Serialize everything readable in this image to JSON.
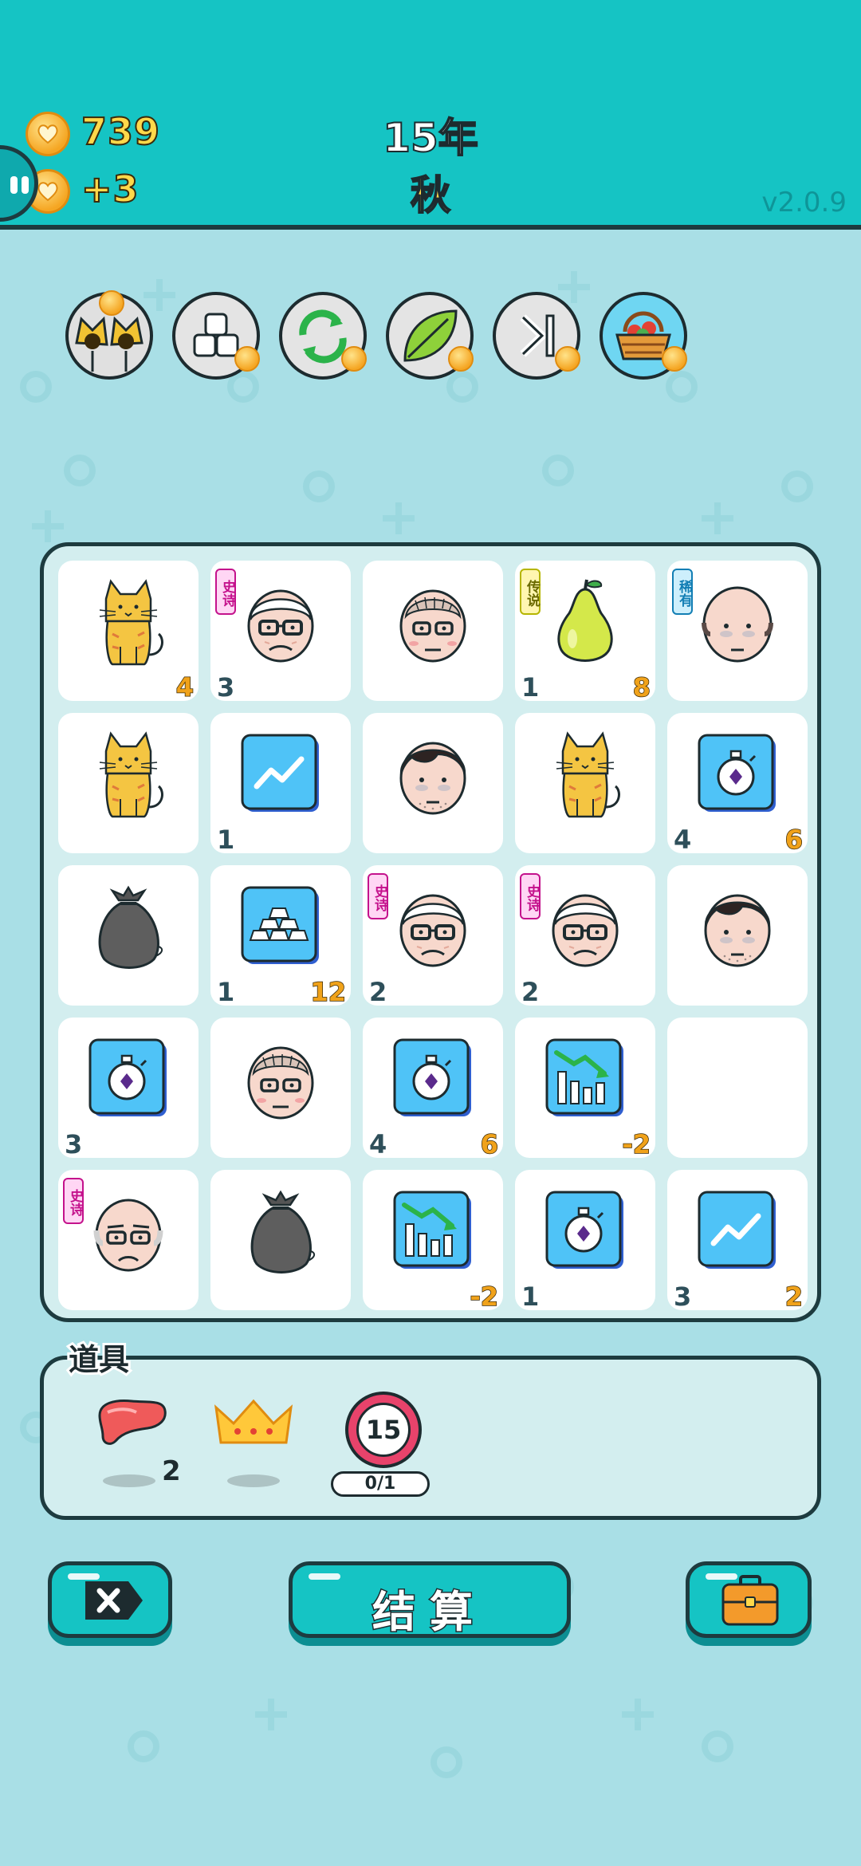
{
  "header": {
    "coins": "739",
    "income": "+3",
    "year": "15年",
    "season": "秋",
    "version": "v2.0.9"
  },
  "skills": [
    {
      "name": "two-cats-skill"
    },
    {
      "name": "sugar-cubes-skill"
    },
    {
      "name": "refresh-skill"
    },
    {
      "name": "leaf-skill"
    },
    {
      "name": "skip-skill"
    },
    {
      "name": "fruit-basket-skill"
    }
  ],
  "board": {
    "rows": [
      [
        {
          "item": "cat",
          "left": "",
          "right": "4",
          "badge": ""
        },
        {
          "item": "old-man-glasses",
          "left": "3",
          "right": "",
          "badge": "史诗",
          "badge_type": "epic"
        },
        {
          "item": "middle-aged-man",
          "left": "",
          "right": "",
          "badge": ""
        },
        {
          "item": "pear",
          "left": "1",
          "right": "8",
          "badge": "传说",
          "badge_type": "legend"
        },
        {
          "item": "bald-man",
          "left": "",
          "right": "",
          "badge": "稀有",
          "badge_type": "rare"
        }
      ],
      [
        {
          "item": "cat",
          "left": "",
          "right": "",
          "badge": ""
        },
        {
          "item": "rising-chart-card",
          "left": "1",
          "right": "",
          "badge": ""
        },
        {
          "item": "young-man",
          "left": "",
          "right": "",
          "badge": ""
        },
        {
          "item": "cat",
          "left": "",
          "right": "",
          "badge": ""
        },
        {
          "item": "stopwatch-card",
          "left": "4",
          "right": "6",
          "badge": ""
        }
      ],
      [
        {
          "item": "garbage-bag",
          "left": "",
          "right": "",
          "badge": ""
        },
        {
          "item": "gold-bars-card",
          "left": "1",
          "right": "12",
          "badge": ""
        },
        {
          "item": "old-man-glasses",
          "left": "2",
          "right": "",
          "badge": "史诗",
          "badge_type": "epic"
        },
        {
          "item": "old-man-glasses",
          "left": "2",
          "right": "",
          "badge": "史诗",
          "badge_type": "epic"
        },
        {
          "item": "young-man",
          "left": "",
          "right": "",
          "badge": ""
        }
      ],
      [
        {
          "item": "stopwatch-card",
          "left": "3",
          "right": "",
          "badge": ""
        },
        {
          "item": "middle-aged-man",
          "left": "",
          "right": "",
          "badge": ""
        },
        {
          "item": "stopwatch-card",
          "left": "4",
          "right": "6",
          "badge": ""
        },
        {
          "item": "falling-chart-card",
          "left": "",
          "right": "-2",
          "badge": ""
        },
        {
          "item": "empty",
          "left": "",
          "right": "",
          "badge": ""
        }
      ],
      [
        {
          "item": "bald-old-man",
          "left": "",
          "right": "",
          "badge": "史诗",
          "badge_type": "epic"
        },
        {
          "item": "garbage-bag",
          "left": "",
          "right": "",
          "badge": ""
        },
        {
          "item": "falling-chart-card",
          "left": "",
          "right": "-2",
          "badge": ""
        },
        {
          "item": "stopwatch-card",
          "left": "1",
          "right": "",
          "badge": ""
        },
        {
          "item": "rising-chart-card",
          "left": "3",
          "right": "2",
          "badge": ""
        }
      ]
    ]
  },
  "items": {
    "label": "道具",
    "liver_count": "2",
    "timer_value": "15",
    "timer_progress": "0/1"
  },
  "buttons": {
    "settle_label": "结算"
  },
  "colors": {
    "header": "#15c4c4",
    "background": "#a9dfe6",
    "outline": "#1d3b3f",
    "coin_gold": "#ffd84a",
    "number_orange": "#f0a21a"
  }
}
